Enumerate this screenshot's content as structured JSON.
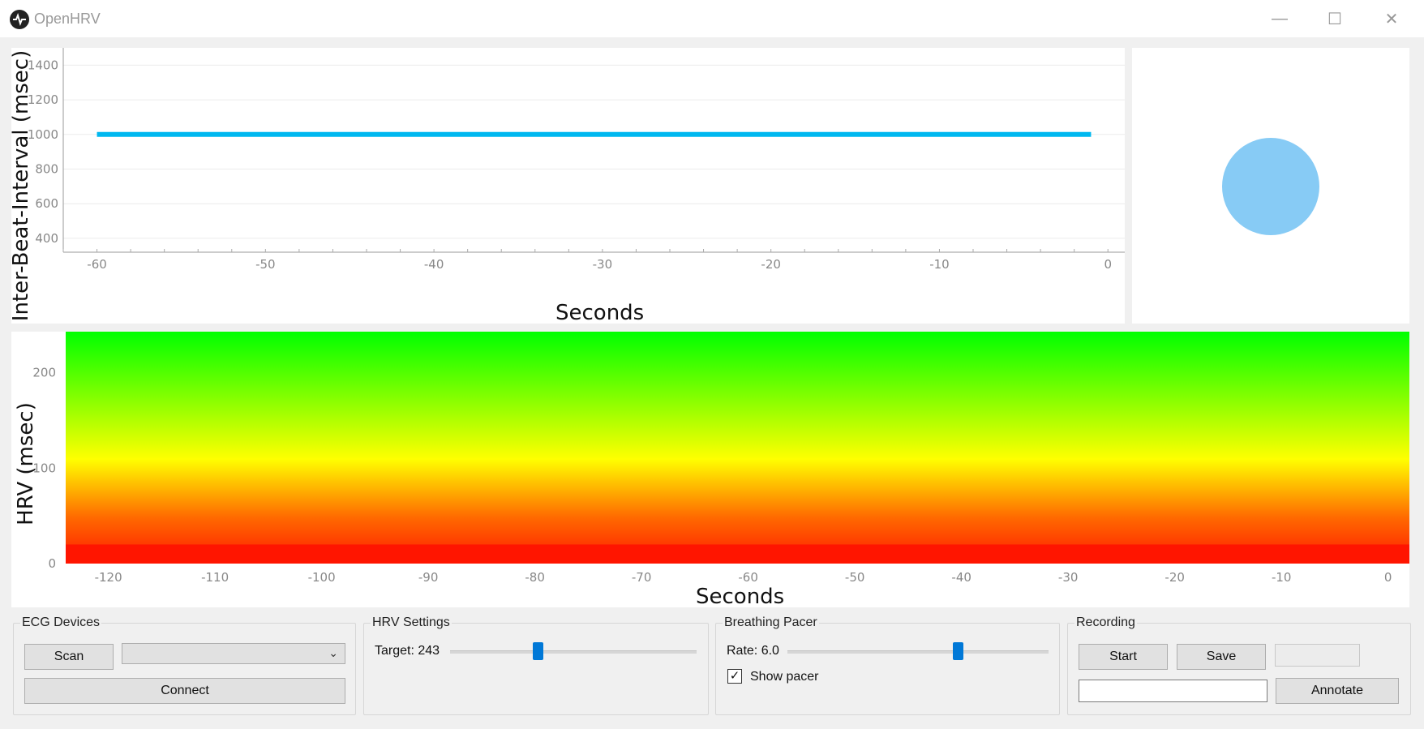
{
  "window": {
    "title": "OpenHRV",
    "controls": {
      "minimize": "—",
      "maximize": "☐",
      "close": "✕"
    }
  },
  "ibi_chart": {
    "ylabel": "Inter-Beat-Interval (msec)",
    "xlabel": "Seconds",
    "y_ticks": [
      "1400",
      "1200",
      "1000",
      "800",
      "600",
      "400"
    ],
    "x_ticks": [
      "-60",
      "-50",
      "-40",
      "-30",
      "-20",
      "-10",
      "0"
    ],
    "line_color": "#00b8f0"
  },
  "hrv_chart": {
    "ylabel": "HRV (msec)",
    "xlabel": "Seconds",
    "y_ticks": [
      "200",
      "100",
      "0"
    ],
    "x_ticks": [
      "-120",
      "-110",
      "-100",
      "-90",
      "-80",
      "-70",
      "-60",
      "-50",
      "-40",
      "-30",
      "-20",
      "-10",
      "0"
    ]
  },
  "chart_data": [
    {
      "type": "line",
      "title": "",
      "xlabel": "Seconds",
      "ylabel": "Inter-Beat-Interval (msec)",
      "x": [
        -60,
        -1
      ],
      "series": [
        {
          "values": [
            1000,
            1000
          ]
        }
      ],
      "xlim": [
        -62,
        1
      ],
      "ylim": [
        320,
        1500
      ],
      "grid": true
    },
    {
      "type": "area",
      "title": "",
      "xlabel": "Seconds",
      "ylabel": "HRV (msec)",
      "x": [
        -121,
        0
      ],
      "series": [
        {
          "values": [
            20,
            20
          ]
        }
      ],
      "xlim": [
        -124,
        2
      ],
      "ylim": [
        0,
        243
      ],
      "background": "gradient red (0) to yellow (~100) to green (~243)"
    }
  ],
  "pacer": {
    "color": "#87cbf5"
  },
  "ecg_devices": {
    "title": "ECG Devices",
    "scan_label": "Scan",
    "device_select_value": "",
    "connect_label": "Connect"
  },
  "hrv_settings": {
    "title": "HRV Settings",
    "target_label": "Target: 243",
    "target_value": 243
  },
  "breathing_pacer": {
    "title": "Breathing Pacer",
    "rate_label": "Rate: 6.0",
    "rate_value": 6.0,
    "show_pacer_label": "Show pacer",
    "show_pacer_checked": true
  },
  "recording": {
    "title": "Recording",
    "start_label": "Start",
    "save_label": "Save",
    "blank_button_label": "",
    "annotation_value": "",
    "annotate_label": "Annotate"
  }
}
